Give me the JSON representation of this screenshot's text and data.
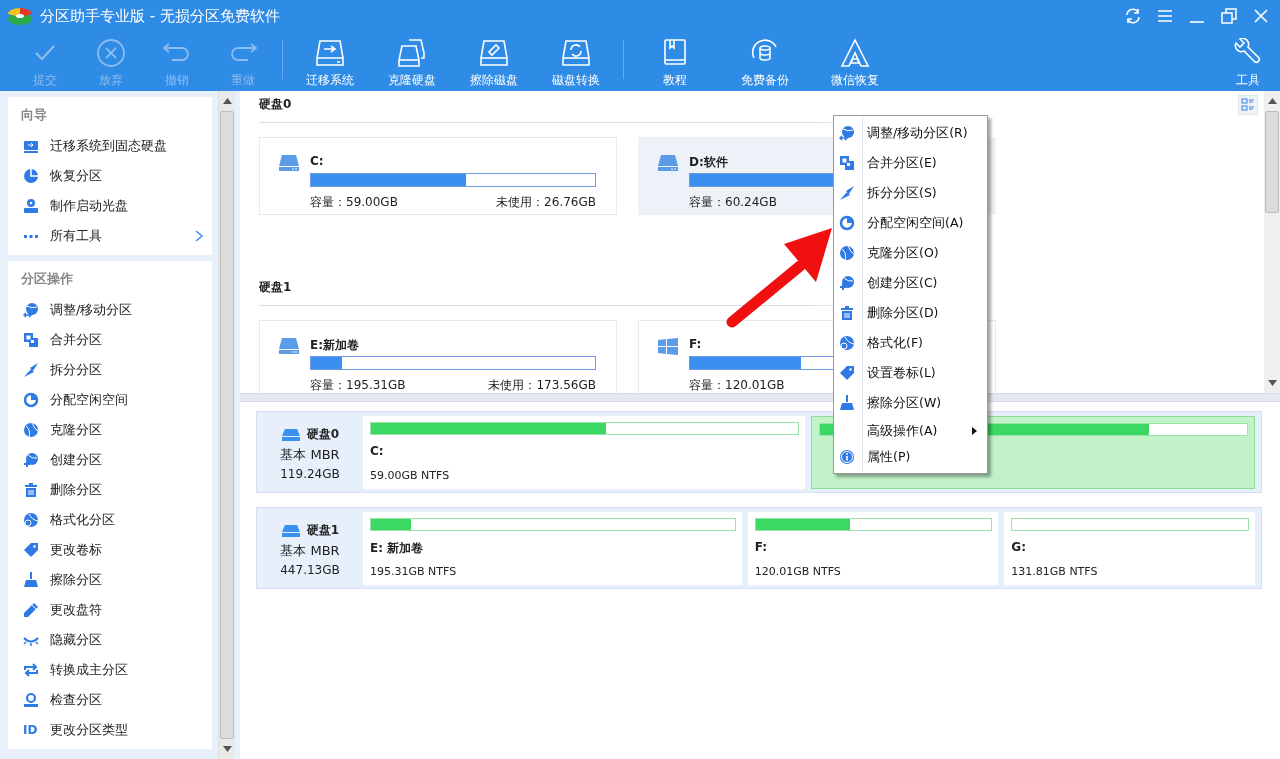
{
  "window": {
    "title": "分区助手专业版 - 无损分区免费软件"
  },
  "toolbar": {
    "groups": [
      {
        "items": [
          {
            "label": "提交",
            "disabled": true
          },
          {
            "label": "放弃",
            "disabled": true
          },
          {
            "label": "撤销",
            "disabled": true
          },
          {
            "label": "重做",
            "disabled": true
          }
        ]
      },
      {
        "items": [
          {
            "label": "迁移系统",
            "disabled": false
          },
          {
            "label": "克隆硬盘",
            "disabled": false
          },
          {
            "label": "擦除磁盘",
            "disabled": false
          },
          {
            "label": "磁盘转换",
            "disabled": false
          }
        ]
      },
      {
        "items": [
          {
            "label": "教程",
            "disabled": false
          },
          {
            "label": "免费备份",
            "disabled": false
          },
          {
            "label": "微信恢复",
            "disabled": false
          }
        ]
      }
    ],
    "right_item": {
      "label": "工具"
    }
  },
  "sidebar": {
    "sections": [
      {
        "title": "向导",
        "items": [
          {
            "label": "迁移系统到固态硬盘",
            "has_submenu": false
          },
          {
            "label": "恢复分区",
            "has_submenu": false
          },
          {
            "label": "制作启动光盘",
            "has_submenu": false
          },
          {
            "label": "所有工具",
            "has_submenu": true
          }
        ]
      },
      {
        "title": "分区操作",
        "items": [
          {
            "label": "调整/移动分区",
            "has_submenu": false
          },
          {
            "label": "合并分区",
            "has_submenu": false
          },
          {
            "label": "拆分分区",
            "has_submenu": false
          },
          {
            "label": "分配空闲空间",
            "has_submenu": false
          },
          {
            "label": "克隆分区",
            "has_submenu": false
          },
          {
            "label": "创建分区",
            "has_submenu": false
          },
          {
            "label": "删除分区",
            "has_submenu": false
          },
          {
            "label": "格式化分区",
            "has_submenu": false
          },
          {
            "label": "更改卷标",
            "has_submenu": false
          },
          {
            "label": "擦除分区",
            "has_submenu": false
          },
          {
            "label": "更改盘符",
            "has_submenu": false
          },
          {
            "label": "隐藏分区",
            "has_submenu": false
          },
          {
            "label": "转换成主分区",
            "has_submenu": false
          },
          {
            "label": "检查分区",
            "has_submenu": false
          },
          {
            "label": "更改分区类型",
            "icon_text": "ID",
            "has_submenu": false
          }
        ]
      }
    ]
  },
  "disks": [
    {
      "title": "硬盘0",
      "partitions": [
        {
          "kind": "drive",
          "name": "C:",
          "level": 0.545,
          "capacity": "容量：59.00GB",
          "unused": "未使用：26.76GB",
          "selected": false
        },
        {
          "kind": "drive",
          "name": "D:软件",
          "level": 0.6,
          "capacity": "容量：60.24GB",
          "selected": true
        }
      ]
    },
    {
      "title": "硬盘1",
      "partitions": [
        {
          "kind": "drive",
          "name": "E:新加卷",
          "level": 0.11,
          "capacity": "容量：195.31GB",
          "unused": "未使用：173.56GB",
          "selected": false
        },
        {
          "kind": "windows",
          "name": "F:",
          "level": 0.39,
          "capacity": "容量：120.01GB",
          "selected": false
        }
      ]
    }
  ],
  "disk_map": [
    {
      "name": "硬盘0",
      "type": "基本 MBR",
      "size": "119.24GB",
      "partitions": [
        {
          "name": "C:",
          "info": "59.00GB NTFS",
          "level": 0.55,
          "selected": false
        },
        {
          "level": 0.77,
          "selected": true
        }
      ]
    },
    {
      "name": "硬盘1",
      "type": "基本 MBR",
      "size": "447.13GB",
      "partitions": [
        {
          "name": "E: 新加卷",
          "info": "195.31GB NTFS",
          "level": 0.11,
          "selected": false
        },
        {
          "name": "F:",
          "info": "120.01GB NTFS",
          "level": 0.4,
          "selected": false
        },
        {
          "name": "G:",
          "info": "131.81GB NTFS",
          "level": 0,
          "selected": false
        }
      ]
    }
  ],
  "context_menu": {
    "items": [
      {
        "label": "调整/移动分区(R)",
        "has_submenu": false
      },
      {
        "label": "合并分区(E)",
        "has_submenu": false
      },
      {
        "label": "拆分分区(S)",
        "has_submenu": false
      },
      {
        "label": "分配空闲空间(A)",
        "has_submenu": false
      },
      {
        "label": "克隆分区(O)",
        "has_submenu": false
      },
      {
        "label": "创建分区(C)",
        "has_submenu": false
      },
      {
        "label": "删除分区(D)",
        "has_submenu": false
      },
      {
        "label": "格式化(F)",
        "has_submenu": false
      },
      {
        "label": "设置卷标(L)",
        "has_submenu": false
      },
      {
        "label": "擦除分区(W)",
        "has_submenu": false
      },
      {
        "label": "高级操作(A)",
        "has_submenu": true
      },
      {
        "label": "属性(P)",
        "has_submenu": false
      }
    ]
  }
}
